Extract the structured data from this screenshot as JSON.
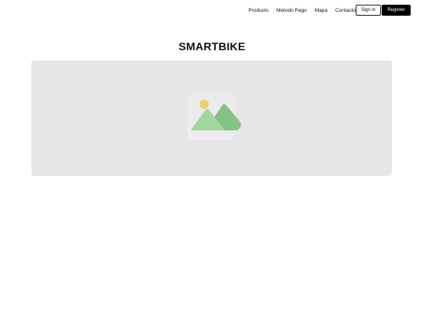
{
  "nav": {
    "links": [
      "Products",
      "Metodo Pago",
      "Mapa",
      "Contacto"
    ],
    "signin_label": "Sign in",
    "register_label": "Register"
  },
  "main": {
    "title": "SMARTBIKE"
  },
  "hero": {
    "image_icon": "image-placeholder-icon",
    "background_color": "#e6e6e6"
  },
  "colors": {
    "accent": "#000000",
    "sun": "#eccf6f",
    "mountain_light": "#a6d6a0",
    "mountain_dark": "#86c282"
  }
}
